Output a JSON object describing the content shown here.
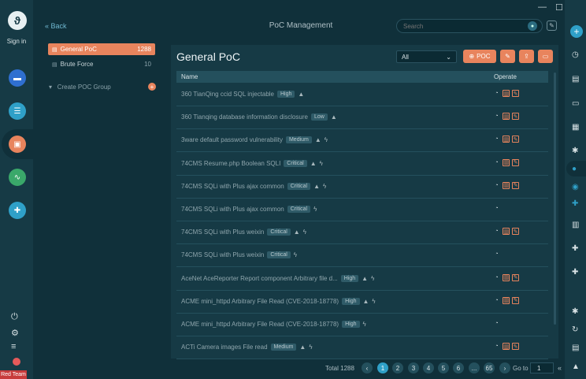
{
  "app": {
    "title": "PoC Management",
    "back_label": "« Back",
    "sign_in": "Sign in",
    "team_badge": "Red Team"
  },
  "search": {
    "placeholder": "Search"
  },
  "window_controls": {
    "minimize": "—",
    "maximize": "☐",
    "close": "✕"
  },
  "sidebar": {
    "items": [
      {
        "label": "General PoC",
        "count": "1288",
        "active": true
      },
      {
        "label": "Brute Force",
        "count": "10",
        "active": false
      }
    ],
    "create_group": "Create POC Group"
  },
  "panel": {
    "title": "General PoC",
    "filter_value": "All",
    "poc_button": "POC",
    "columns": {
      "name": "Name",
      "operate": "Operate"
    }
  },
  "rows": [
    {
      "name": "360 TianQing ccid SQL injectable",
      "level": "High",
      "warn": true,
      "bolt": false,
      "deletable": true
    },
    {
      "name": "360 Tianqing database information disclosure",
      "level": "Low",
      "warn": true,
      "bolt": false,
      "deletable": true
    },
    {
      "name": "3ware default password vulnerability",
      "level": "Medium",
      "warn": true,
      "bolt": true,
      "deletable": true
    },
    {
      "name": "74CMS Resume.php Boolean SQLI",
      "level": "Critical",
      "warn": true,
      "bolt": true,
      "deletable": true
    },
    {
      "name": "74CMS SQLi with Plus ajax common",
      "level": "Critical",
      "warn": true,
      "bolt": true,
      "deletable": true
    },
    {
      "name": "74CMS SQLi with Plus ajax common",
      "level": "Critical",
      "warn": false,
      "bolt": true,
      "deletable": false
    },
    {
      "name": "74CMS SQLi with Plus weixin",
      "level": "Critical",
      "warn": true,
      "bolt": true,
      "deletable": true
    },
    {
      "name": "74CMS SQLi with Plus weixin",
      "level": "Critical",
      "warn": false,
      "bolt": true,
      "deletable": false
    },
    {
      "name": "AceNet AceReporter Report component Arbitrary file d...",
      "level": "High",
      "warn": true,
      "bolt": true,
      "deletable": true
    },
    {
      "name": "ACME mini_httpd Arbitrary File Read (CVE-2018-18778)",
      "level": "High",
      "warn": true,
      "bolt": true,
      "deletable": true
    },
    {
      "name": "ACME mini_httpd Arbitrary File Read (CVE-2018-18778)",
      "level": "High",
      "warn": false,
      "bolt": true,
      "deletable": false
    },
    {
      "name": "ACTi Camera images File read",
      "level": "Medium",
      "warn": true,
      "bolt": true,
      "deletable": true
    }
  ],
  "pagination": {
    "total": "Total 1288",
    "pages": [
      "1",
      "2",
      "3",
      "4",
      "5",
      "6",
      "...",
      "65"
    ],
    "current": "1",
    "goto_label": "Go to",
    "goto_value": "1"
  },
  "colors": {
    "accent": "#e8845d",
    "primary": "#2fa0c8",
    "background": "#10303a",
    "panel": "#163a45"
  }
}
